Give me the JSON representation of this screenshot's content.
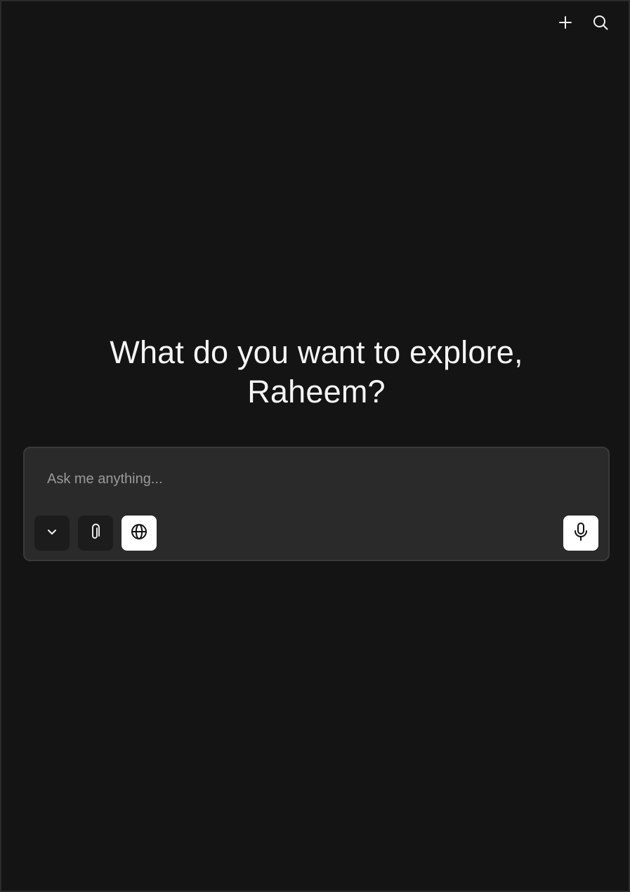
{
  "header": {
    "actions": [
      {
        "icon": "plus-icon",
        "label": "New"
      },
      {
        "icon": "search-icon",
        "label": "Search"
      }
    ]
  },
  "hero": {
    "title": "What do you want to explore,\nRaheem?"
  },
  "composer": {
    "placeholder": "Ask me anything...",
    "value": "",
    "tools": [
      {
        "icon": "chevron-down-icon",
        "active": false
      },
      {
        "icon": "paperclip-icon",
        "active": false
      },
      {
        "icon": "globe-icon",
        "active": true
      },
      {
        "icon": "microphone-icon",
        "active": true
      }
    ]
  },
  "colors": {
    "background": "#141414",
    "composer_bg": "#2a2a2a",
    "composer_border": "#3a3a3a",
    "text": "#f5f5f5",
    "placeholder": "#9a9a9a",
    "tool_dark": "#1c1c1c",
    "tool_light": "#ffffff"
  }
}
